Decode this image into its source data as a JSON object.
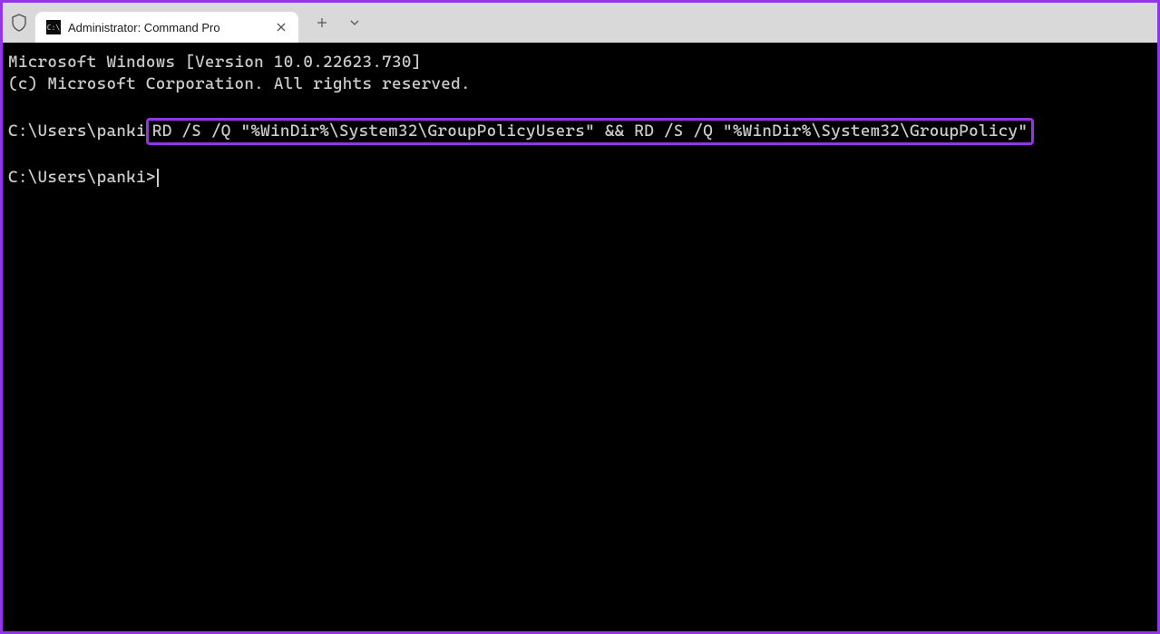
{
  "titlebar": {
    "tab_title": "Administrator: Command Pro"
  },
  "terminal": {
    "line1": "Microsoft Windows [Version 10.0.22623.730]",
    "line2": "(c) Microsoft Corporation. All rights reserved.",
    "prompt1_prefix": "C:\\Users\\panki",
    "highlighted_command": "RD /S /Q \"%WinDir%\\System32\\GroupPolicyUsers\" && RD /S /Q \"%WinDir%\\System32\\GroupPolicy\"",
    "prompt2": "C:\\Users\\panki>"
  }
}
